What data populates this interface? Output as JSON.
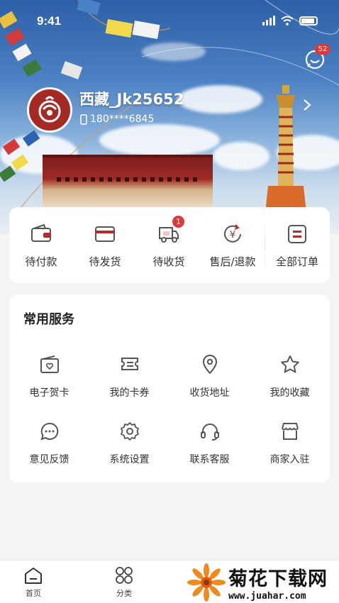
{
  "status": {
    "time": "9:41"
  },
  "header": {
    "message_badge": "52",
    "username": "西藏_Jk25652",
    "phone": "180****6845"
  },
  "orders": [
    {
      "label": "待付款",
      "icon": "wallet-icon"
    },
    {
      "label": "待发货",
      "icon": "package-icon"
    },
    {
      "label": "待收货",
      "icon": "truck-icon",
      "badge": "1"
    },
    {
      "label": "售后/退款",
      "icon": "refund-icon"
    },
    {
      "label": "全部订单",
      "icon": "order-list-icon"
    }
  ],
  "services": {
    "title": "常用服务",
    "items": [
      {
        "label": "电子贺卡",
        "icon": "greeting-card-icon"
      },
      {
        "label": "我的卡券",
        "icon": "coupon-icon"
      },
      {
        "label": "收货地址",
        "icon": "location-pin-icon"
      },
      {
        "label": "我的收藏",
        "icon": "star-icon"
      },
      {
        "label": "意见反馈",
        "icon": "chat-bubble-icon"
      },
      {
        "label": "系统设置",
        "icon": "gear-icon"
      },
      {
        "label": "联系客服",
        "icon": "headset-icon"
      },
      {
        "label": "商家入驻",
        "icon": "store-icon"
      }
    ]
  },
  "tabbar": [
    {
      "label": "首页",
      "icon": "home-icon"
    },
    {
      "label": "分类",
      "icon": "category-icon"
    }
  ],
  "watermark": {
    "cn": "菊花下载网",
    "url": "www.juahar.com"
  },
  "colors": {
    "accent": "#b8292a",
    "badge": "#d93a3a",
    "icon": "#555555"
  }
}
